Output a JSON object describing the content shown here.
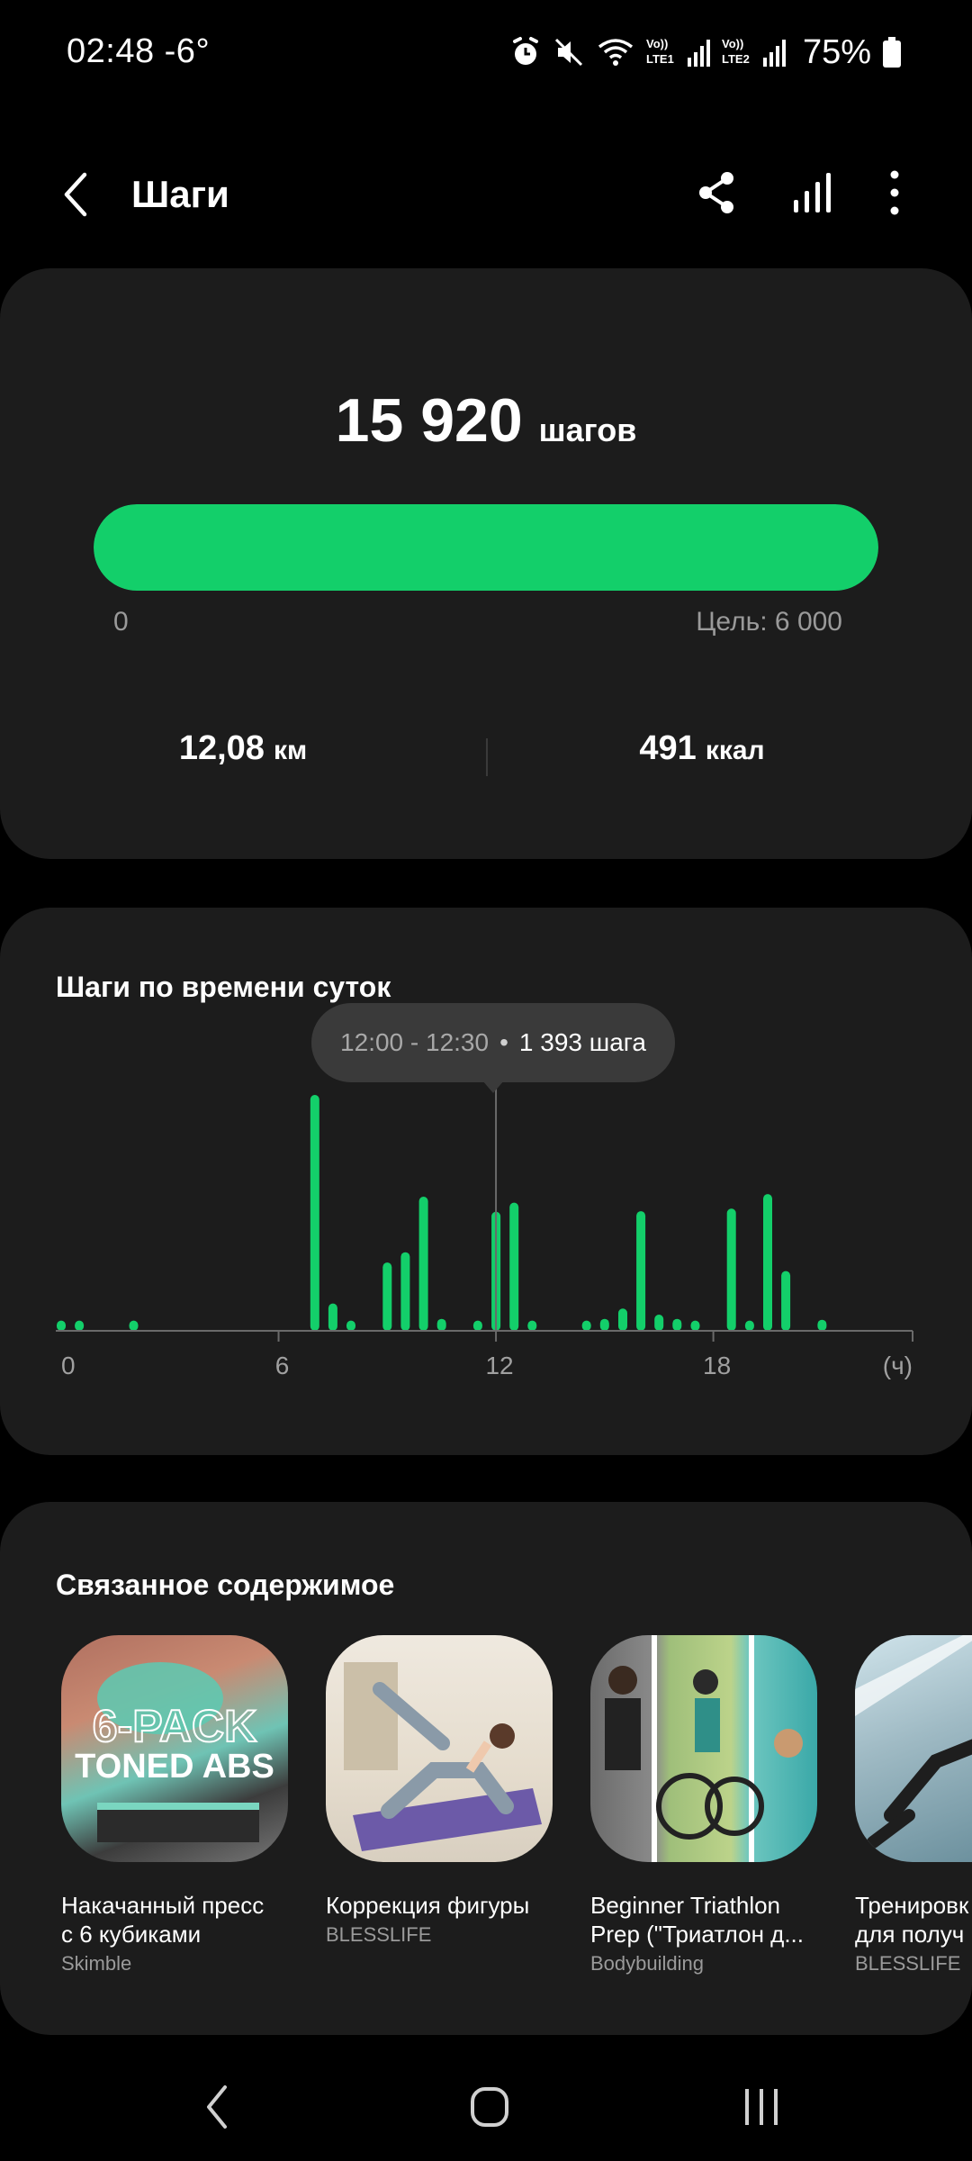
{
  "status_bar": {
    "time": "02:48",
    "temperature": "-6°",
    "sim1": "Vo)) LTE1",
    "sim2": "Vo)) LTE2",
    "battery": "75%",
    "icons": [
      "alarm-icon",
      "mute-icon",
      "wifi-icon",
      "signal-icon",
      "battery-icon"
    ]
  },
  "header": {
    "title": "Шаги",
    "icons": [
      "back-icon",
      "share-icon",
      "bar-chart-icon",
      "more-icon"
    ]
  },
  "steps_card": {
    "value": "15 920",
    "unit": "шагов",
    "progress_min": "0",
    "goal_label": "Цель: 6 000",
    "progress_fraction": 1.0,
    "distance_value": "12,08",
    "distance_unit": "км",
    "calories_value": "491",
    "calories_unit": "ккал"
  },
  "chart_card": {
    "title": "Шаги по времени суток",
    "tooltip_time": "12:00 - 12:30",
    "tooltip_value": "1 393 шага",
    "accent_color": "#13cf6a"
  },
  "chart_data": {
    "type": "bar",
    "x_ticks": [
      "0",
      "6",
      "12",
      "18"
    ],
    "x_unit": "(ч)",
    "xlim": [
      0,
      23.5
    ],
    "selected_x": 12.0,
    "selected_value": 1393,
    "x": [
      0.0,
      0.5,
      2.0,
      7.0,
      7.5,
      8.0,
      9.0,
      9.5,
      10.0,
      10.5,
      11.5,
      12.0,
      12.5,
      13.0,
      14.5,
      15.0,
      15.5,
      16.0,
      16.5,
      17.0,
      17.5,
      18.5,
      19.0,
      19.5,
      20.0,
      21.0
    ],
    "values": [
      120,
      120,
      120,
      2760,
      320,
      120,
      800,
      920,
      1570,
      140,
      120,
      1393,
      1500,
      120,
      120,
      140,
      260,
      1400,
      190,
      140,
      120,
      1430,
      120,
      1600,
      700,
      130
    ]
  },
  "related_card": {
    "title": "Связанное содержимое",
    "items": [
      {
        "line1": "Накачанный пресс",
        "line2": "с 6 кубиками",
        "source": "Skimble",
        "thumb_text1": "6-PACK",
        "thumb_text2": "TONED ABS"
      },
      {
        "line1": "Коррекция фигуры",
        "line2": "",
        "source": "BLESSLIFE"
      },
      {
        "line1": "Beginner Triathlon",
        "line2": "Prep (\"Триатлон д...",
        "source": "Bodybuilding"
      },
      {
        "line1": "Тренировк",
        "line2": "для получ",
        "source": "BLESSLIFE"
      }
    ]
  },
  "nav_bar": {
    "icons": [
      "nav-back-icon",
      "nav-home-icon",
      "nav-recents-icon"
    ]
  }
}
